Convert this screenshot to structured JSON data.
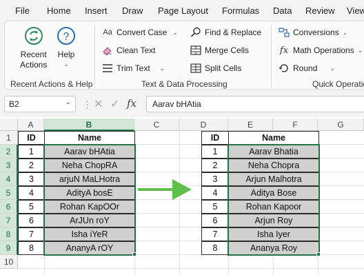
{
  "menu": {
    "items": [
      "File",
      "Home",
      "Insert",
      "Draw",
      "Page Layout",
      "Formulas",
      "Data",
      "Review",
      "View"
    ]
  },
  "ribbon": {
    "recent": {
      "recent_actions_label": "Recent\nActions",
      "help_label": "Help",
      "group_label": "Recent Actions & Help"
    },
    "text_proc": {
      "convert_case": "Convert Case",
      "clean_text": "Clean Text",
      "trim_text": "Trim Text",
      "find_replace": "Find & Replace",
      "merge_cells": "Merge Cells",
      "split_cells": "Split Cells",
      "group_label": "Text & Data Processing"
    },
    "quick": {
      "conversions": "Conversions",
      "math_operations": "Math Operations",
      "round": "Round",
      "group_label": "Quick Operations"
    }
  },
  "formula_bar": {
    "cell_ref": "B2",
    "formula": "Aarav bHAtia"
  },
  "columns": [
    "A",
    "B",
    "C",
    "D",
    "E",
    "F",
    "G"
  ],
  "rows": [
    "1",
    "2",
    "3",
    "4",
    "5",
    "6",
    "7",
    "8",
    "9",
    "10"
  ],
  "left_table": {
    "headers": {
      "id": "ID",
      "name": "Name"
    },
    "ids": [
      "1",
      "2",
      "3",
      "4",
      "5",
      "6",
      "7",
      "8"
    ],
    "names": [
      "Aarav bHAtia",
      "Neha ChopRA",
      "arjuN MaLHotra",
      "AdityA bosE",
      "Rohan KapOOr",
      "ArJUn roY",
      "Isha iYeR",
      "AnanyA rOY"
    ]
  },
  "right_table": {
    "headers": {
      "id": "ID",
      "name": "Name"
    },
    "ids": [
      "1",
      "2",
      "3",
      "4",
      "5",
      "6",
      "7",
      "8"
    ],
    "names": [
      "Aarav Bhatia",
      "Neha Chopra",
      "Arjun Malhotra",
      "Aditya Bose",
      "Rohan Kapoor",
      "Arjun Roy",
      "Isha Iyer",
      "Ananya Roy"
    ]
  },
  "colors": {
    "excel_green": "#217346",
    "arrow_green": "#5fbf4a",
    "name_fill": "#d0d0d0"
  }
}
